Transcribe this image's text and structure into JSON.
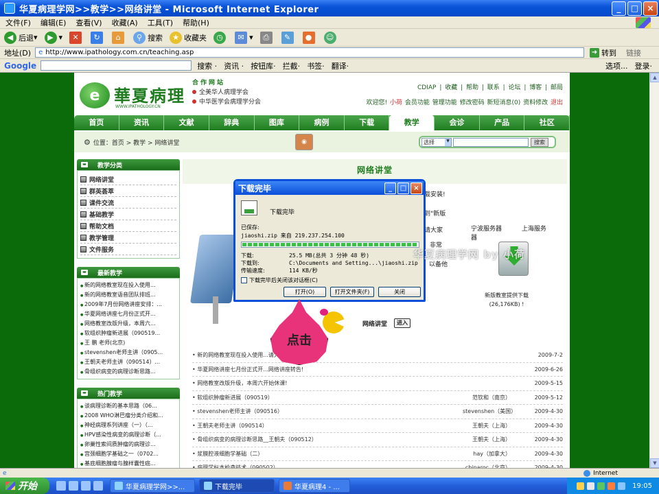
{
  "window": {
    "title": "华夏病理学网>>教学>>网络讲堂 - Microsoft Internet Explorer",
    "minimize": "_",
    "maximize": "□",
    "close": "×"
  },
  "menu": [
    "文件(F)",
    "编辑(E)",
    "查看(V)",
    "收藏(A)",
    "工具(T)",
    "帮助(H)"
  ],
  "toolbar": {
    "back": "后退",
    "search": "搜索",
    "favorites": "收藏夹"
  },
  "address": {
    "label": "地址(D)",
    "url": "http://www.ipathology.com.cn/teaching.asp",
    "go": "转到",
    "links": "链接"
  },
  "google": {
    "logo": "Google",
    "items": [
      "搜索 ·",
      "资讯 ·",
      "按钮库·",
      "拦截·",
      "书签·",
      "翻译·"
    ],
    "options": "选项...",
    "login": "登录·"
  },
  "site": {
    "logo_char": "e",
    "logo_text": "華夏病理",
    "logo_url": "WWW.IPATHOLOGY.CN",
    "partners_title": "合作网站",
    "partners": [
      "全美华人病理学会",
      "中华医学会病理学分会"
    ],
    "toplinks": "CDIAP | 收藏 | 帮助 | 联系 | 论坛 | 博客 | 邮局",
    "welcome": "欢迎您!",
    "username": "小荷",
    "userlinks": "会员功能 管理功能 修改密码  新短消息(0) 资料修改",
    "logout": "退出",
    "nav": [
      "首页",
      "资讯",
      "文献",
      "辞典",
      "图库",
      "病例",
      "下载",
      "教学",
      "会诊",
      "产品",
      "社区"
    ],
    "nav_active_index": 7,
    "breadcrumb": "位置：首页 > 教学 > 网络讲堂",
    "search_select": "选择",
    "search_button": "搜索"
  },
  "left": {
    "category_title": "教学分类",
    "categories": [
      "网络讲堂",
      "群英荟萃",
      "课件交流",
      "基础教学",
      "帮助文档",
      "教学管理",
      "文件服务"
    ],
    "latest_title": "最新教学",
    "latest": [
      "新的网络教室现在投入使用...",
      "新的网络教室语音团队排班...",
      "2009年7月份网络讲座安排：...",
      "华夏网络讲座七月份正式开...",
      "网络教室改版升级，本周六...",
      "软组织肿瘤新进展（090519...",
      "王 鹏 老师(北京)",
      "stevenshen老师主讲（0905...",
      "王朝夫老师主讲（090514）...",
      "骨组织病变的病理诊断思路..."
    ],
    "hot_title": "热门教学",
    "hot": [
      "谈病理诊断的基本思路（06...",
      "2008 WHO淋巴瘤分类介绍和...",
      "神经病理系列讲座（一）（...",
      "HPV感染性病变的病理诊断（...",
      "卵巢性索间质肿瘤的病理诊...",
      "宫颈细胞学基础之一（0702...",
      "基底细胞腺瘤与腺样囊性癌..."
    ]
  },
  "right": {
    "title": "网络讲堂",
    "frag1": "载安装!",
    "frag2": "到\"新版",
    "frag3": "请大家",
    "frag4": "非常",
    "frag5": "，以备他",
    "server1": "宁波服务器",
    "server2": "上海服务器",
    "server_note": "新版教室提供下载",
    "server_size": "(26,176KB) !",
    "netlink": "网络讲堂",
    "enter": "进入",
    "news": [
      {
        "title": "新的网络教室现在投入使用...请大家下载安装!",
        "author": "",
        "date": "2009-7-2"
      },
      {
        "title": "华夏网络讲座七月份正式开...网络讲座转告!",
        "author": "",
        "date": "2009-6-26"
      },
      {
        "title": "网络教室改版升级，本周六开始休课!",
        "author": "",
        "date": "2009-5-15"
      },
      {
        "title": "软组织肿瘤新进展（090519）",
        "author": "范钦和（南京）",
        "date": "2009-5-12"
      },
      {
        "title": "stevenshen老师主讲（090516）",
        "author": "stevenshen（美国）",
        "date": "2009-4-30"
      },
      {
        "title": "王朝夫老师主讲（090514）",
        "author": "王朝夫（上海）",
        "date": "2009-4-30"
      },
      {
        "title": "骨组织病变的病理诊断思路__王朝夫（090512）",
        "author": "王朝夫（上海）",
        "date": "2009-4-30"
      },
      {
        "title": "浆膜腔液细胞学基础（二）",
        "author": "hay（加拿大）",
        "date": "2009-4-30"
      },
      {
        "title": "病理学标本检查技术（090502）",
        "author": "chinaroc（北京）",
        "date": "2009-4-30"
      }
    ]
  },
  "dialog": {
    "title": "下载完毕",
    "status": "下载完毕",
    "saved_label": "已保存:",
    "saved_value": "jiaoshi.zip 来自 219.237.254.100",
    "progress": 1.0,
    "downloaded_label": "下载:",
    "downloaded_value": "25.5 MB(总共 3 分钟 48 秒)",
    "to_label": "下载到:",
    "to_value": "C:\\Documents and Setting...\\jiaoshi.zip",
    "rate_label": "传输速度:",
    "rate_value": "114 KB/秒",
    "checkbox": "下载完毕后关闭该对话框(C)",
    "open": "打开(O)",
    "open_folder": "打开文件夹(F)",
    "close": "关闭"
  },
  "watermark": "华夏病理学网  by 小荷",
  "callout": "点击",
  "statusbar": {
    "zone": "Internet"
  },
  "taskbar": {
    "start": "开始",
    "tasks": [
      "华夏病理学网>>...",
      "下载完毕",
      "华夏病理4 - ..."
    ],
    "clock": "19:05"
  }
}
